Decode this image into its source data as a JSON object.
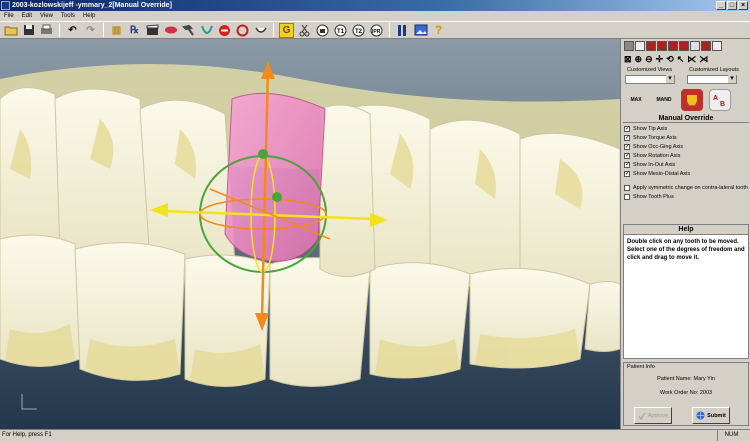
{
  "window": {
    "title": "2003-kozlowskijeff -ymmary_2[Manual Override]"
  },
  "menu": [
    "File",
    "Edit",
    "View",
    "Tools",
    "Help"
  ],
  "toolbar_icons": [
    "open-folder-icon",
    "save-icon",
    "print-icon",
    "undo-icon",
    "redo-icon",
    "book-icon",
    "prescription-icon",
    "clapper-icon",
    "lips-icon",
    "hammer-icon",
    "arch-icon",
    "stop-icon",
    "rotate-icon",
    "smile-icon",
    "gold-icon",
    "cut-icon",
    "tooth-icon",
    "t1-icon",
    "t2-icon",
    "ipr-icon",
    "stage-icon",
    "picture-icon",
    "help-icon"
  ],
  "toolbar_glyphs": {
    "open": "📂",
    "save": "💾",
    "print": "🖶",
    "undo": "↶",
    "redo": "↷",
    "book": "▥",
    "rx": "℞",
    "g": "G",
    "help": "?"
  },
  "right_panel": {
    "customized_views_label": "Customized Views",
    "customized_layouts_label": "Customized Layouts",
    "big_icons": [
      "MAX",
      "MAND",
      "",
      ""
    ],
    "manual_override_title": "Manual Override",
    "checkboxes": [
      {
        "label": "Show Tip Axis",
        "checked": true
      },
      {
        "label": "Show Torque Axis",
        "checked": true
      },
      {
        "label": "Show Occ-Ging Axis",
        "checked": true
      },
      {
        "label": "Show Rotation Axis",
        "checked": true
      },
      {
        "label": "Show In-Out Axis",
        "checked": true
      },
      {
        "label": "Show Mesio-Distal Axis",
        "checked": true
      }
    ],
    "options": [
      {
        "label": "Apply symmetric change on contra-lateral tooth",
        "checked": false
      },
      {
        "label": "Show Tooth Plus",
        "checked": false
      }
    ],
    "help_title": "Help",
    "help_text": "Double click on any tooth to be moved. Select one of the degrees of freedom and click and drag to move it.",
    "patient_info_label": "Patient Info",
    "patient_name": "Patient Name: Mary Yin",
    "work_order": "Work Order No: 2003",
    "approve_label": "Approve",
    "submit_label": "Submit"
  },
  "status": {
    "left": "For Help, press F1",
    "num": "NUM"
  },
  "colors": {
    "gum_bg": "#5a6b79",
    "tooth": "#f4f1dd",
    "plaque": "#e6db9a",
    "selected_tooth": "#e98ac4",
    "axis_orange": "#f28a1c",
    "axis_yellow": "#f0e31b",
    "axis_green": "#4ba33b"
  }
}
